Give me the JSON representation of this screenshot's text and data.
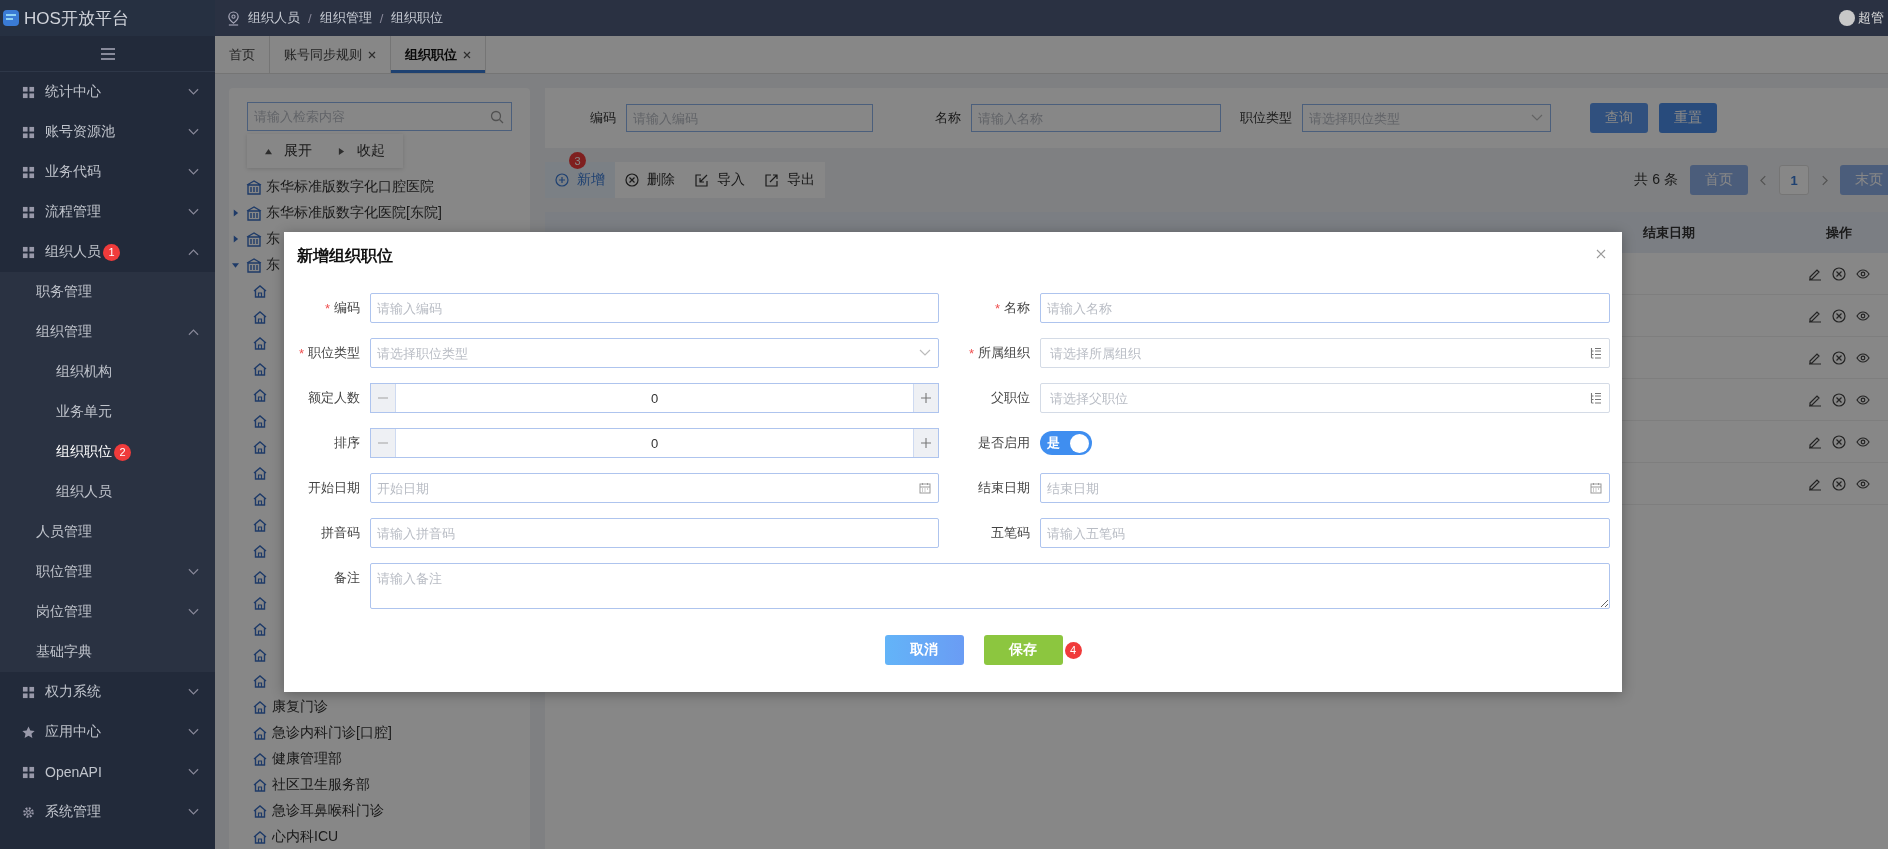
{
  "sidebar": {
    "title": "HOS开放平台",
    "items": [
      {
        "label": "统计中心",
        "kind": "grid",
        "expanded": false,
        "selected": false
      },
      {
        "label": "账号资源池",
        "kind": "grid",
        "expanded": false,
        "selected": false
      },
      {
        "label": "业务代码",
        "kind": "grid",
        "expanded": false,
        "selected": false
      },
      {
        "label": "流程管理",
        "kind": "grid",
        "expanded": false,
        "selected": false
      },
      {
        "label": "组织人员",
        "kind": "grid",
        "expanded": true,
        "selected": false,
        "marker": "1",
        "children": [
          {
            "label": "职务管理",
            "selected": false
          },
          {
            "label": "组织管理",
            "expanded": true,
            "selected": false,
            "children": [
              {
                "label": "组织机构",
                "selected": false
              },
              {
                "label": "业务单元",
                "selected": false
              },
              {
                "label": "组织职位",
                "selected": true,
                "marker": "2"
              },
              {
                "label": "组织人员",
                "selected": false
              }
            ]
          },
          {
            "label": "人员管理",
            "selected": false
          },
          {
            "label": "职位管理",
            "expanded": false,
            "selected": false
          },
          {
            "label": "岗位管理",
            "expanded": false,
            "selected": false
          },
          {
            "label": "基础字典",
            "selected": false
          }
        ]
      },
      {
        "label": "权力系统",
        "kind": "grid",
        "expanded": false,
        "selected": false
      },
      {
        "label": "应用中心",
        "kind": "star",
        "expanded": false,
        "selected": false
      },
      {
        "label": "OpenAPI",
        "kind": "grid",
        "expanded": false,
        "selected": false
      },
      {
        "label": "系统管理",
        "kind": "gear",
        "expanded": false,
        "selected": false
      }
    ]
  },
  "breadcrumb": [
    "组织人员",
    "组织管理",
    "组织职位"
  ],
  "breadcrumb_separator": "/",
  "user": {
    "name": "超管"
  },
  "tabs": [
    {
      "label": "首页",
      "closable": false,
      "selected": false
    },
    {
      "label": "账号同步规则",
      "closable": true,
      "selected": false
    },
    {
      "label": "组织职位",
      "closable": true,
      "selected": true
    }
  ],
  "tree": {
    "search_placeholder": "请输入检索内容",
    "expand_label": "展开",
    "collapse_label": "收起",
    "nodes": [
      {
        "label": "东华标准版数字化口腔医院"
      },
      {
        "label": "东华标准版数字化医院[东院]",
        "expanded": false
      },
      {
        "label": "东",
        "expanded": false
      },
      {
        "label": "东",
        "expanded": true,
        "children": [
          {
            "kind": "covered"
          },
          {
            "kind": "covered"
          },
          {
            "kind": "covered"
          },
          {
            "kind": "covered"
          },
          {
            "kind": "covered"
          },
          {
            "kind": "covered"
          },
          {
            "kind": "covered"
          },
          {
            "kind": "covered"
          },
          {
            "kind": "covered"
          },
          {
            "kind": "covered"
          },
          {
            "kind": "covered"
          },
          {
            "kind": "covered"
          },
          {
            "kind": "covered"
          },
          {
            "kind": "covered"
          },
          {
            "kind": "covered"
          },
          {
            "kind": "covered"
          },
          {
            "kind": "dept",
            "label": "康复门诊"
          },
          {
            "kind": "dept",
            "label": "急诊内科门诊[口腔]"
          },
          {
            "kind": "dept",
            "label": "健康管理部"
          },
          {
            "kind": "dept",
            "label": "社区卫生服务部"
          },
          {
            "kind": "dept",
            "label": "急诊耳鼻喉科门诊"
          },
          {
            "kind": "dept",
            "label": "心内科ICU"
          }
        ]
      }
    ]
  },
  "search": {
    "fields": [
      {
        "kind": "text",
        "label": "编码",
        "placeholder": "请输入编码"
      },
      {
        "kind": "text",
        "label": "名称",
        "placeholder": "请输入名称"
      },
      {
        "kind": "select",
        "label": "职位类型",
        "placeholder": "请选择职位类型"
      }
    ],
    "buttons": [
      "查询",
      "重置"
    ]
  },
  "toolbar": [
    {
      "kind": "add",
      "label": "新增",
      "marker": "3"
    },
    {
      "kind": "delete",
      "label": "删除"
    },
    {
      "kind": "import",
      "label": "导入"
    },
    {
      "kind": "export",
      "label": "导出"
    }
  ],
  "pagination": {
    "total": "共 6 条",
    "first": "首页",
    "pages": [
      {
        "label": "1",
        "selected": true
      }
    ],
    "last": "末页"
  },
  "table": {
    "columns": [
      "结束日期",
      "操作"
    ],
    "rows": [
      {
        "kind": "actions"
      },
      {
        "kind": "actions"
      },
      {
        "kind": "actions"
      },
      {
        "kind": "actions"
      },
      {
        "kind": "actions"
      },
      {
        "kind": "actions"
      }
    ]
  },
  "dialog": {
    "title": "新增组织职位",
    "required_mark": "*",
    "fields": [
      {
        "kind": "text",
        "label": "编码",
        "required": true,
        "placeholder": "请输入编码"
      },
      {
        "kind": "text",
        "label": "名称",
        "required": true,
        "placeholder": "请输入名称"
      },
      {
        "kind": "select",
        "label": "职位类型",
        "required": true,
        "placeholder": "请选择职位类型"
      },
      {
        "kind": "tree-select",
        "label": "所属组织",
        "required": true,
        "placeholder": "请选择所属组织"
      },
      {
        "kind": "number",
        "label": "额定人数",
        "required": false,
        "value": "0"
      },
      {
        "kind": "tree-select",
        "label": "父职位",
        "required": false,
        "placeholder": "请选择父职位"
      },
      {
        "kind": "number",
        "label": "排序",
        "required": false,
        "value": "0"
      },
      {
        "kind": "switch",
        "label": "是否启用",
        "required": false,
        "on": true,
        "text": "是"
      },
      {
        "kind": "date",
        "label": "开始日期",
        "required": false,
        "placeholder": "开始日期"
      },
      {
        "kind": "date",
        "label": "结束日期",
        "required": false,
        "placeholder": "结束日期"
      },
      {
        "kind": "text",
        "label": "拼音码",
        "required": false,
        "placeholder": "请输入拼音码"
      },
      {
        "kind": "text",
        "label": "五笔码",
        "required": false,
        "placeholder": "请输入五笔码"
      },
      {
        "kind": "textarea",
        "label": "备注",
        "required": false,
        "placeholder": "请输入备注"
      }
    ],
    "buttons": [
      {
        "kind": "cancel",
        "label": "取消"
      },
      {
        "kind": "primary",
        "label": "保存",
        "marker": "4"
      }
    ]
  }
}
